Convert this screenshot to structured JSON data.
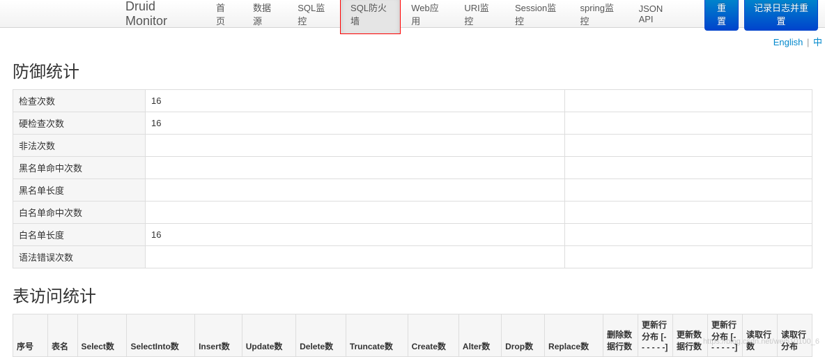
{
  "brand": "Druid Monitor",
  "nav": {
    "items": [
      {
        "label": "首页"
      },
      {
        "label": "数据源"
      },
      {
        "label": "SQL监控"
      },
      {
        "label": "SQL防火墙",
        "active": true
      },
      {
        "label": "Web应用"
      },
      {
        "label": "URI监控"
      },
      {
        "label": "Session监控"
      },
      {
        "label": "spring监控"
      },
      {
        "label": "JSON API"
      }
    ]
  },
  "buttons": {
    "reset": "重置",
    "log_reset": "记录日志并重置"
  },
  "lang": {
    "english": "English",
    "sep": "|",
    "chinese": "中"
  },
  "defense_stats": {
    "title": "防御统计",
    "rows": [
      {
        "label": "检查次数",
        "value": "16"
      },
      {
        "label": "硬检查次数",
        "value": "16"
      },
      {
        "label": "非法次数",
        "value": ""
      },
      {
        "label": "黑名单命中次数",
        "value": ""
      },
      {
        "label": "黑名单长度",
        "value": ""
      },
      {
        "label": "白名单命中次数",
        "value": ""
      },
      {
        "label": "白名单长度",
        "value": "16"
      },
      {
        "label": "语法错误次数",
        "value": ""
      }
    ]
  },
  "table_access": {
    "title": "表访问统计",
    "headers": [
      "序号",
      "表名",
      "Select数",
      "SelectInto数",
      "Insert数",
      "Update数",
      "Delete数",
      "Truncate数",
      "Create数",
      "Alter数",
      "Drop数",
      "Replace数",
      "删除数据行数",
      "更新行分布 [- - - - - -]",
      "更新数据行数",
      "更新行分布 [- - - - - -]",
      "读取行数",
      "读取行分布"
    ]
  },
  "watermark": "https://blog.csdn.net/wei510100_6"
}
